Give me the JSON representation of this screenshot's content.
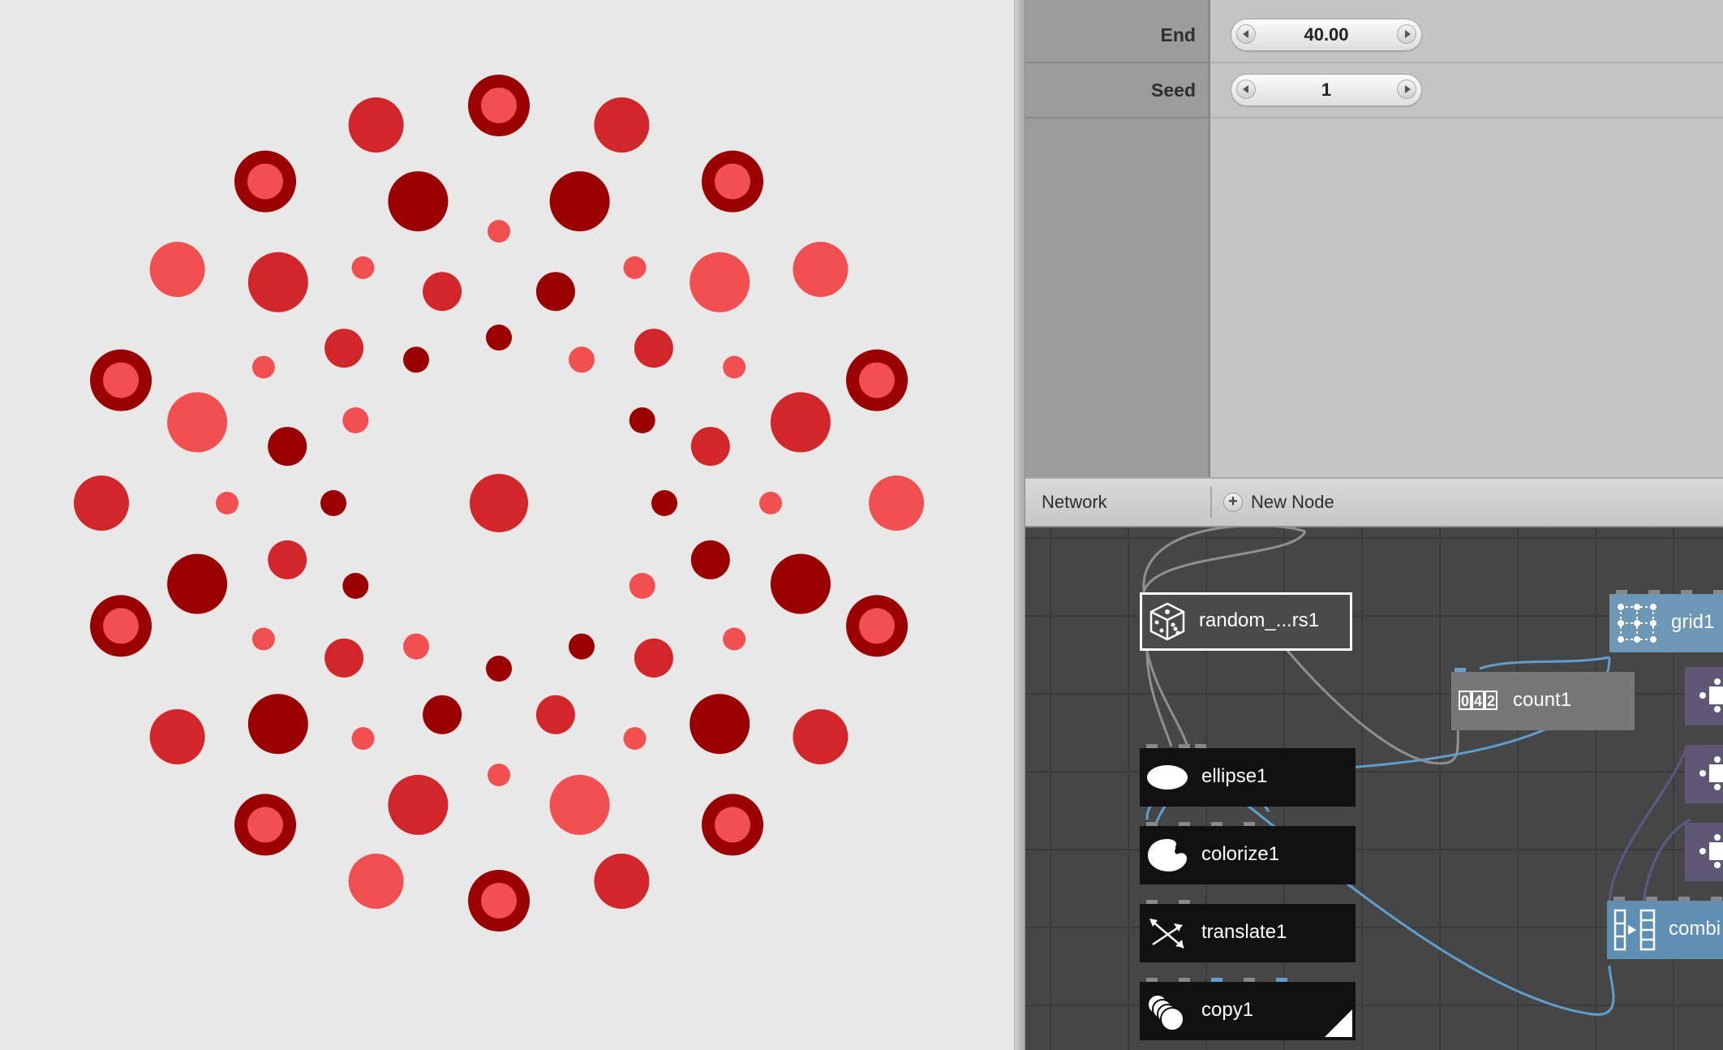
{
  "viewer": {
    "colors": {
      "dark": "#9b0000",
      "medium": "#d2272a",
      "light": "#f24f50"
    }
  },
  "parameters": {
    "rows": [
      {
        "label": "End",
        "value": "40.00"
      },
      {
        "label": "Seed",
        "value": "1"
      }
    ]
  },
  "network_panel": {
    "title": "Network",
    "new_node_label": "New Node",
    "nodes": [
      {
        "id": "random",
        "label": "random_...rs1",
        "icon": "dice-icon",
        "selected": true
      },
      {
        "id": "ellipse",
        "label": "ellipse1",
        "icon": "ellipse-icon"
      },
      {
        "id": "colorize",
        "label": "colorize1",
        "icon": "palette-icon"
      },
      {
        "id": "translate",
        "label": "translate1",
        "icon": "move-arrows-icon"
      },
      {
        "id": "copy",
        "label": "copy1",
        "icon": "copy-stack-icon",
        "rendered": true
      },
      {
        "id": "count",
        "label": "count1",
        "icon": "counter-icon"
      },
      {
        "id": "grid",
        "label": "grid1",
        "icon": "grid-icon"
      },
      {
        "id": "combine",
        "label": "combi",
        "icon": "combine-icon"
      }
    ]
  }
}
